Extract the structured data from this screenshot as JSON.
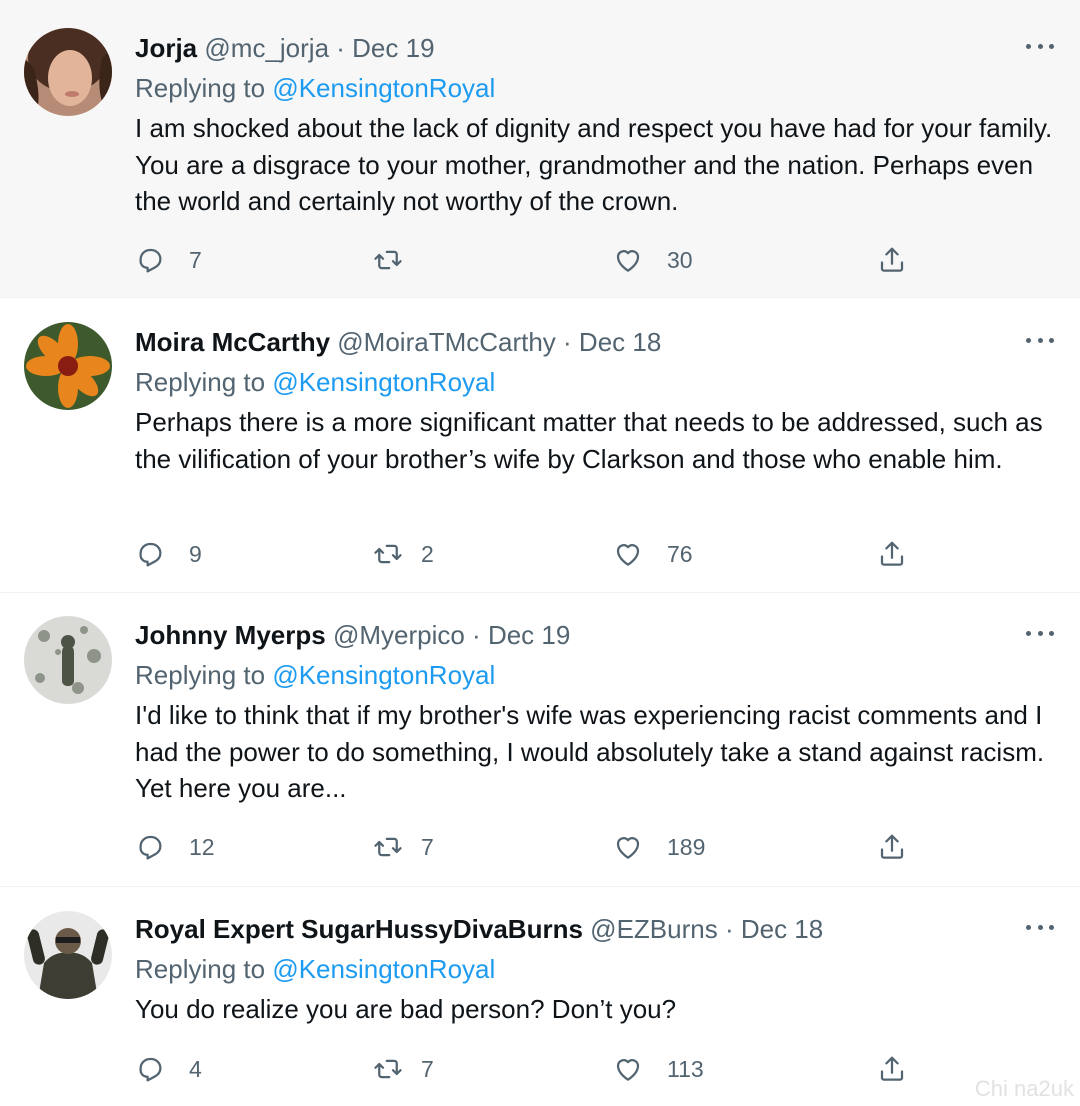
{
  "tweets": [
    {
      "name": "Jorja",
      "handle": "@mc_jorja",
      "date": "Dec 19",
      "replying_prefix": "Replying to",
      "replying_handle": "@KensingtonRoyal",
      "text": "I am shocked about the lack of dignity and respect you have had for your family. You are a disgrace to your mother, grandmother and the nation. Perhaps even the world and certainly not worthy of the crown.",
      "replies": "7",
      "retweets": "",
      "likes": "30"
    },
    {
      "name": "Moira McCarthy",
      "handle": "@MoiraTMcCarthy",
      "date": "Dec 18",
      "replying_prefix": "Replying to",
      "replying_handle": "@KensingtonRoyal",
      "text": "Perhaps there is a more significant matter that needs to be addressed, such as the vilification of your brother’s wife by Clarkson and those who enable him.",
      "replies": "9",
      "retweets": "2",
      "likes": "76"
    },
    {
      "name": "Johnny Myerps",
      "handle": "@Myerpico",
      "date": "Dec 19",
      "replying_prefix": "Replying to",
      "replying_handle": "@KensingtonRoyal",
      "text": "I'd like to think that if my brother's wife was experiencing racist comments and I had the power to do something, I would absolutely take a stand against racism. Yet here you are...",
      "replies": "12",
      "retweets": "7",
      "likes": "189"
    },
    {
      "name": "Royal Expert SugarHussyDivaBurns",
      "handle": "@EZBurns",
      "date": "Dec 18",
      "replying_prefix": "Replying to",
      "replying_handle": "@KensingtonRoyal",
      "text": "You do realize you are bad person? Don’t you?",
      "replies": "4",
      "retweets": "7",
      "likes": "113"
    }
  ],
  "separator": " · ",
  "icons": {
    "reply": "reply-icon",
    "retweet": "retweet-icon",
    "like": "heart-icon",
    "share": "share-icon",
    "more": "more-icon"
  },
  "colors": {
    "link": "#1d9bf0",
    "muted": "#536471",
    "text": "#0f1419",
    "highlight_bg": "#f7f7f7"
  },
  "watermark": "Chi na2uk"
}
